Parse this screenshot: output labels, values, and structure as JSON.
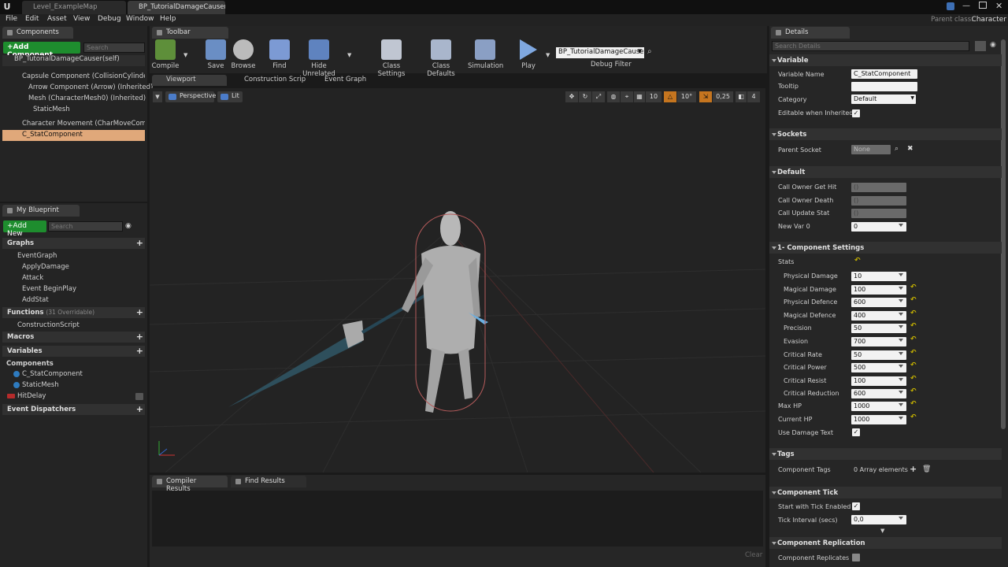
{
  "doc_tabs": [
    "Level_ExampleMap",
    "BP_TutorialDamageCauser"
  ],
  "menu": [
    "File",
    "Edit",
    "Asset",
    "View",
    "Debug",
    "Window",
    "Help"
  ],
  "parent_class": {
    "label": "Parent class:",
    "value": "Character"
  },
  "components_panel": {
    "title": "Components",
    "add_button": "+Add Component",
    "search_placeholder": "Search",
    "self_item": "BP_TutorialDamageCauser(self)",
    "items": [
      "Capsule Component (CollisionCylinder) (Inh",
      "Arrow Component (Arrow) (Inherited)",
      "Mesh (CharacterMesh0) (Inherited)",
      "StaticMesh",
      "Character Movement (CharMoveComp) (Inh",
      "C_StatComponent"
    ]
  },
  "my_blueprint": {
    "title": "My Blueprint",
    "add_button": "+Add New",
    "search_placeholder": "Search",
    "graphs_header": "Graphs",
    "event_graph": "EventGraph",
    "events": [
      "ApplyDamage",
      "Attack",
      "Event BeginPlay",
      "AddStat"
    ],
    "functions_header": "Functions",
    "functions_count": "(31 Overridable)",
    "construction_script": "ConstructionScript",
    "macros_header": "Macros",
    "variables_header": "Variables",
    "components_header": "Components",
    "component_vars": [
      "C_StatComponent",
      "StaticMesh"
    ],
    "hit_delay": "HitDelay",
    "dispatchers_header": "Event Dispatchers"
  },
  "toolbar": {
    "title": "Toolbar",
    "items": [
      "Compile",
      "Save",
      "Browse",
      "Find",
      "Hide Unrelated",
      "Class Settings",
      "Class Defaults",
      "Simulation",
      "Play"
    ],
    "debug_select": "BP_TutorialDamageCauser",
    "debug_filter": "Debug Filter"
  },
  "editor_tabs": [
    "Viewport",
    "Construction Scrip",
    "Event Graph"
  ],
  "viewport": {
    "perspective": "Perspective",
    "lit": "Lit",
    "grid_snap": "10",
    "rot_snap": "10°",
    "scale_snap": "0,25",
    "cam_speed": "4"
  },
  "bottom_tabs": [
    "Compiler Results",
    "Find Results"
  ],
  "clear_label": "Clear",
  "details": {
    "title": "Details",
    "search_placeholder": "Search Details",
    "variable_section": "Variable",
    "variable_name_label": "Variable Name",
    "variable_name": "C_StatComponent",
    "tooltip_label": "Tooltip",
    "tooltip": "",
    "category_label": "Category",
    "category": "Default",
    "editable_label": "Editable when Inherited",
    "sockets_section": "Sockets",
    "parent_socket_label": "Parent Socket",
    "parent_socket": "None",
    "default_section": "Default",
    "default_rows": [
      {
        "label": "Call Owner Get Hit",
        "value": "()"
      },
      {
        "label": "Call Owner Death",
        "value": "()"
      },
      {
        "label": "Call Update Stat",
        "value": "()"
      },
      {
        "label": "New Var 0",
        "value": "0"
      }
    ],
    "comp_section": "1- Component Settings",
    "stats_label": "Stats",
    "stats": [
      {
        "label": "Physical Damage",
        "value": "10"
      },
      {
        "label": "Magical Damage",
        "value": "100"
      },
      {
        "label": "Physical Defence",
        "value": "600"
      },
      {
        "label": "Magical Defence",
        "value": "400"
      },
      {
        "label": "Precision",
        "value": "50"
      },
      {
        "label": "Evasion",
        "value": "700"
      },
      {
        "label": "Critical Rate",
        "value": "50"
      },
      {
        "label": "Critical Power",
        "value": "500"
      },
      {
        "label": "Critical Resist",
        "value": "100"
      },
      {
        "label": "Critical Reduction",
        "value": "600"
      }
    ],
    "max_hp_label": "Max HP",
    "max_hp": "1000",
    "current_hp_label": "Current HP",
    "current_hp": "1000",
    "use_damage_text_label": "Use Damage Text",
    "tags_section": "Tags",
    "component_tags_label": "Component Tags",
    "component_tags": "0 Array elements",
    "tick_section": "Component Tick",
    "start_tick_label": "Start with Tick Enabled",
    "tick_interval_label": "Tick Interval (secs)",
    "tick_interval": "0,0",
    "replication_section": "Component Replication",
    "replicates_label": "Component Replicates"
  },
  "colors": {
    "accent_green": "#1e8d2e",
    "selection": "#e0a87a",
    "reset_yellow": "#c8b400"
  }
}
